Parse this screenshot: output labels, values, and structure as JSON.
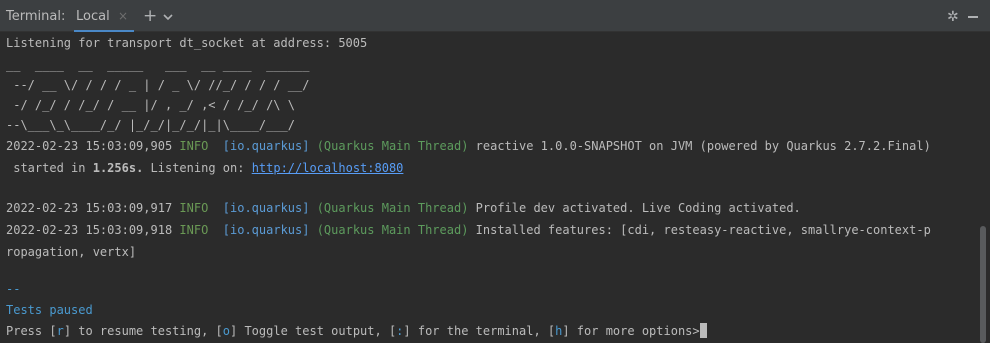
{
  "header": {
    "title": "Terminal:",
    "tab_label": "Local",
    "tab_close": "×",
    "new_tab": "+",
    "gear": "✲",
    "icons": [
      "close-icon",
      "plus-icon",
      "chevron-down-icon",
      "gear-icon",
      "minimize-icon"
    ]
  },
  "console": {
    "listening": "Listening for transport dt_socket at address: 5005",
    "banner": [
      "__  ____  __  _____   ___  __ ____  ______",
      " --/ __ \\/ / / / _ | / _ \\/ //_/ / / / __/",
      " -/ /_/ / /_/ / __ |/ , _/ ,< / /_/ /\\ \\",
      "--\\___\\_\\____/_/ |_/_/|_/_/|_|\\____/___/"
    ],
    "log1": {
      "ts": "2022-02-23 15:03:09,905",
      "level": "INFO",
      "cat": "[io.quarkus]",
      "thread": "(Quarkus Main Thread)",
      "msg": "reactive 1.0.0-SNAPSHOT on JVM (powered by Quarkus 2.7.2.Final)",
      "cont_pre": "started in",
      "cont_time": "1.256s.",
      "cont_listen": "Listening on:",
      "url": "http://localhost:8080"
    },
    "log2": {
      "ts": "2022-02-23 15:03:09,917",
      "level": "INFO",
      "cat": "[io.quarkus]",
      "thread": "(Quarkus Main Thread)",
      "msg": "Profile dev activated. Live Coding activated."
    },
    "log3": {
      "ts": "2022-02-23 15:03:09,918",
      "level": "INFO",
      "cat": "[io.quarkus]",
      "thread": "(Quarkus Main Thread)",
      "msg": "Installed features: [cdi, resteasy-reactive, smallrye-context-p",
      "cont": "ropagation, vertx]"
    },
    "sep": "--",
    "tests_paused": "Tests paused",
    "prompt": {
      "press": "Press [",
      "k_r": "r",
      "t_r": "] to resume testing, [",
      "k_o": "o",
      "t_o": "] Toggle test output, [",
      "k_colon": ":",
      "t_colon": "] for the terminal, [",
      "k_h": "h",
      "t_h": "] for more options>"
    }
  },
  "colors": {
    "background": "#2b2b2b",
    "toolbar": "#3c3f41",
    "text": "#bbbbbb",
    "info": "#6a9955",
    "category": "#5b9bd5",
    "thread": "#5d9b5d",
    "link": "#589df6",
    "tab_underline": "#4a88c7"
  }
}
